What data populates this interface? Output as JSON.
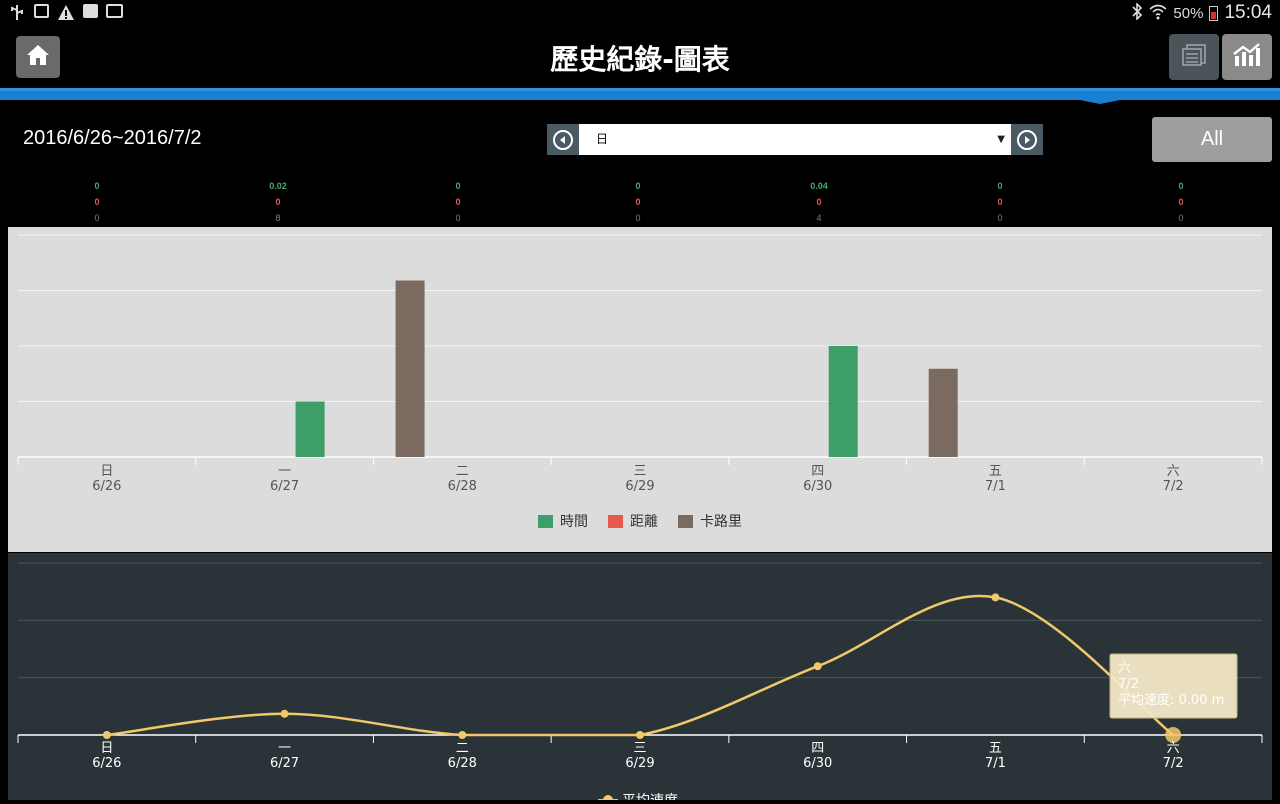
{
  "status_bar": {
    "battery_percent": "50%",
    "time": "15:04",
    "icons": [
      "usb-icon",
      "image-icon",
      "warning-icon",
      "clipboard-check-icon",
      "briefcase-icon",
      "bluetooth-icon",
      "wifi-icon",
      "battery-icon"
    ]
  },
  "header": {
    "title": "歷史紀錄-圖表",
    "home_icon": "home-icon",
    "list_view_icon": "list-view-icon",
    "chart_view_icon": "line-chart-icon"
  },
  "filter": {
    "date_range": "2016/6/26~2016/7/2",
    "period": "日",
    "all_label": "All"
  },
  "summary": {
    "columns": [
      {
        "time": "0",
        "distance": "0",
        "calories": "0"
      },
      {
        "time": "0.02",
        "distance": "0",
        "calories": "8"
      },
      {
        "time": "0",
        "distance": "0",
        "calories": "0"
      },
      {
        "time": "0",
        "distance": "0",
        "calories": "0"
      },
      {
        "time": "0.04",
        "distance": "0",
        "calories": "4"
      },
      {
        "time": "0",
        "distance": "0",
        "calories": "0"
      },
      {
        "time": "0",
        "distance": "0",
        "calories": "0"
      }
    ]
  },
  "colors": {
    "time": "#3e9e68",
    "distance": "#e8584f",
    "calories": "#7a6a60",
    "speed": "#f1c86a",
    "accent": "#1a7fd0"
  },
  "chart_data": [
    {
      "type": "bar",
      "categories": [
        "日\n6/26",
        "一\n6/27",
        "二\n6/28",
        "三\n6/29",
        "四\n6/30",
        "五\n7/1",
        "六\n7/2"
      ],
      "weekday_labels": [
        "日",
        "一",
        "二",
        "三",
        "四",
        "五",
        "六"
      ],
      "date_labels": [
        "6/26",
        "6/27",
        "6/28",
        "6/29",
        "6/30",
        "7/1",
        "7/2"
      ],
      "series": [
        {
          "name": "時間",
          "values": [
            0,
            0.02,
            0,
            0,
            0.04,
            0,
            0
          ]
        },
        {
          "name": "距離",
          "values": [
            0,
            0,
            0,
            0,
            0,
            0,
            0
          ]
        },
        {
          "name": "卡路里",
          "values": [
            0,
            8,
            0,
            0,
            4,
            0,
            0
          ]
        }
      ],
      "grid": true,
      "legend": "bottom-center"
    },
    {
      "type": "line",
      "categories": [
        "日\n6/26",
        "一\n6/27",
        "二\n6/28",
        "三\n6/29",
        "四\n6/30",
        "五\n7/1",
        "六\n7/2"
      ],
      "series": [
        {
          "name": "平均速度",
          "values": [
            0,
            0.37,
            0,
            0,
            1.2,
            2.4,
            0
          ]
        }
      ],
      "grid": true,
      "legend": "bottom-center",
      "tooltip": {
        "weekday": "六",
        "date": "7/2",
        "text": "平均速度: 0.00 m"
      }
    }
  ]
}
